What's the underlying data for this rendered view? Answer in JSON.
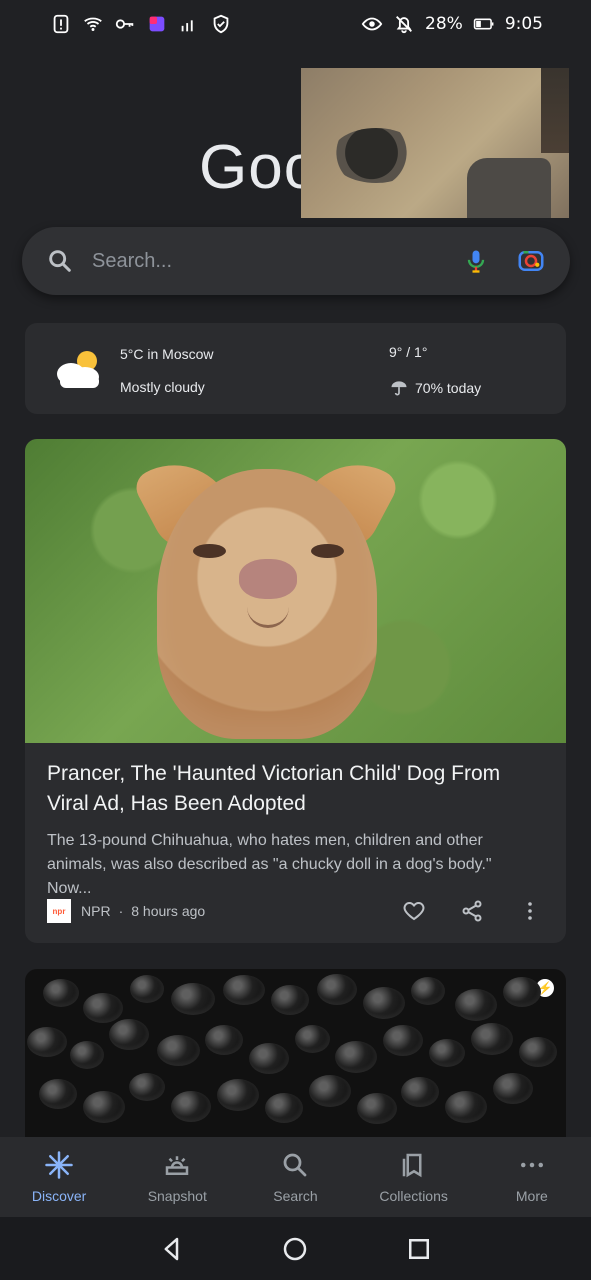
{
  "status_bar": {
    "battery_percent": "28%",
    "time": "9:05",
    "left_icons": [
      "alert-icon",
      "wifi-icon",
      "key-icon",
      "app-icon",
      "signal-icon",
      "shield-icon"
    ],
    "right_icons": [
      "eye-icon",
      "bell-off-icon",
      "battery-icon"
    ]
  },
  "header": {
    "logo_text": "Goo"
  },
  "search": {
    "placeholder": "Search..."
  },
  "weather": {
    "temperature_location": "5°C in Moscow",
    "condition": "Mostly cloudy",
    "high_low": "9° / 1°",
    "precipitation": "70% today"
  },
  "news_card": {
    "title": "Prancer, The 'Haunted Victorian Child' Dog From Viral Ad, Has Been Adopted",
    "snippet": "The 13-pound Chihuahua, who hates men, children and other animals, was also described as \"a chucky doll in a dog's body.\" Now...",
    "source": "NPR",
    "separator": "·",
    "time_ago": "8 hours ago",
    "source_logo_text": "npr"
  },
  "bottom_nav": {
    "items": [
      {
        "label": "Discover"
      },
      {
        "label": "Snapshot"
      },
      {
        "label": "Search"
      },
      {
        "label": "Collections"
      },
      {
        "label": "More"
      }
    ]
  },
  "colors": {
    "background": "#202124",
    "card": "#2b2c2f",
    "accent_blue": "#8ab4f8",
    "mic_blue": "#4285f4",
    "mic_red": "#ea4335",
    "lens_yellow": "#fbbc05",
    "lens_green": "#34a853"
  }
}
